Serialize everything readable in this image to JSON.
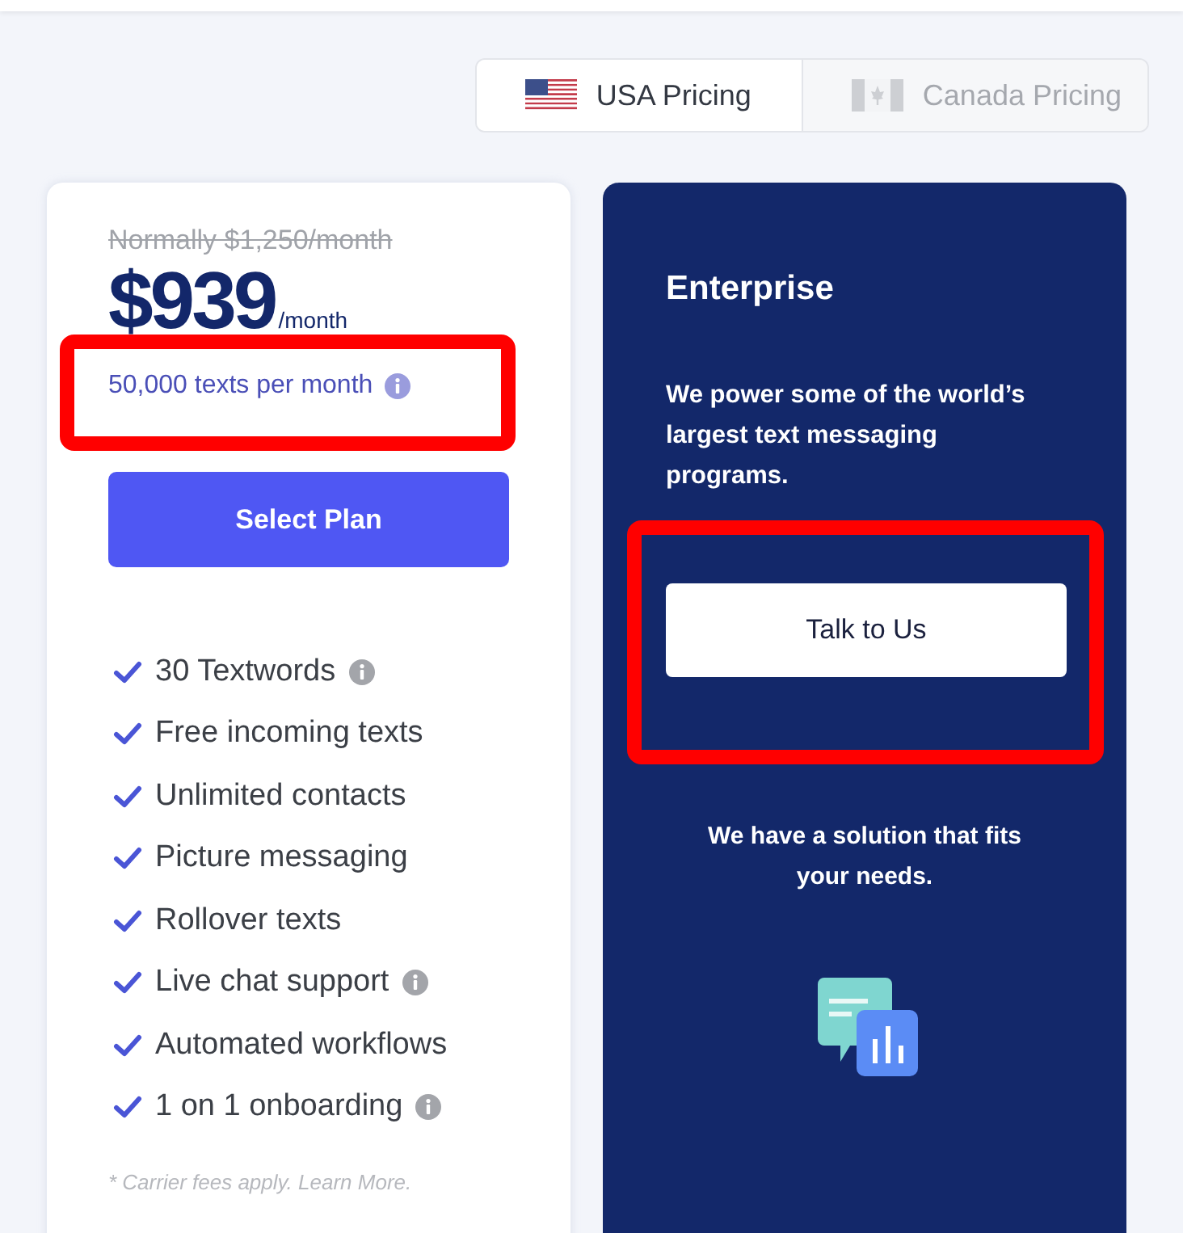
{
  "region_toggle": [
    {
      "label": "USA Pricing",
      "kind": "usa",
      "selected": true
    },
    {
      "label": "Canada Pricing",
      "kind": "canada",
      "selected": false
    }
  ],
  "plan": {
    "normal_price": "Normally $1,250/month",
    "price": "$939",
    "per": "/month",
    "texts_per_month": {
      "label": "50,000 texts per month",
      "info": true,
      "highlighted": true
    },
    "button": "Select Plan",
    "features": [
      {
        "text": "30 Textwords",
        "info": true
      },
      {
        "text": "Free incoming texts",
        "info": false
      },
      {
        "text": "Unlimited contacts",
        "info": false
      },
      {
        "text": "Picture messaging",
        "info": false
      },
      {
        "text": "Rollover texts",
        "info": false
      },
      {
        "text": "Live chat support",
        "info": true
      },
      {
        "text": "Automated workflows",
        "info": false
      },
      {
        "text": "1 on 1 onboarding",
        "info": true
      }
    ],
    "footnote": "* Carrier fees apply. Learn More."
  },
  "enterprise": {
    "title": "Enterprise",
    "description": "We power some of the world’s largest text messaging programs.",
    "button": {
      "label": "Talk to Us",
      "highlighted": true
    },
    "note": "We have a solution that fits your needs."
  }
}
